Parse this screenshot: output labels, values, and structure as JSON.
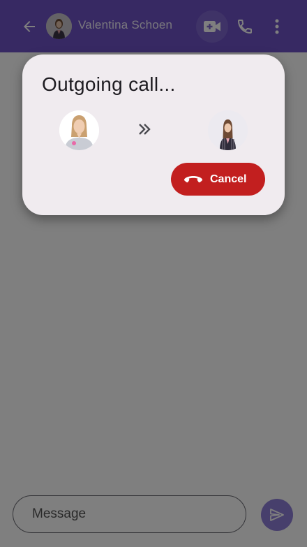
{
  "appbar": {
    "contact_name": "Valentina Schoen",
    "icons": {
      "back": "arrow-left-icon",
      "video": "video-call-icon",
      "phone": "phone-icon",
      "more": "more-vert-icon"
    },
    "background_color": "#6e52c6"
  },
  "dialog": {
    "title": "Outgoing call...",
    "cancel_label": "Cancel",
    "cancel_color": "#c21f1f",
    "arrow_icon": "double-chevron-right-icon"
  },
  "composer": {
    "placeholder": "Message",
    "send_icon": "send-icon"
  }
}
